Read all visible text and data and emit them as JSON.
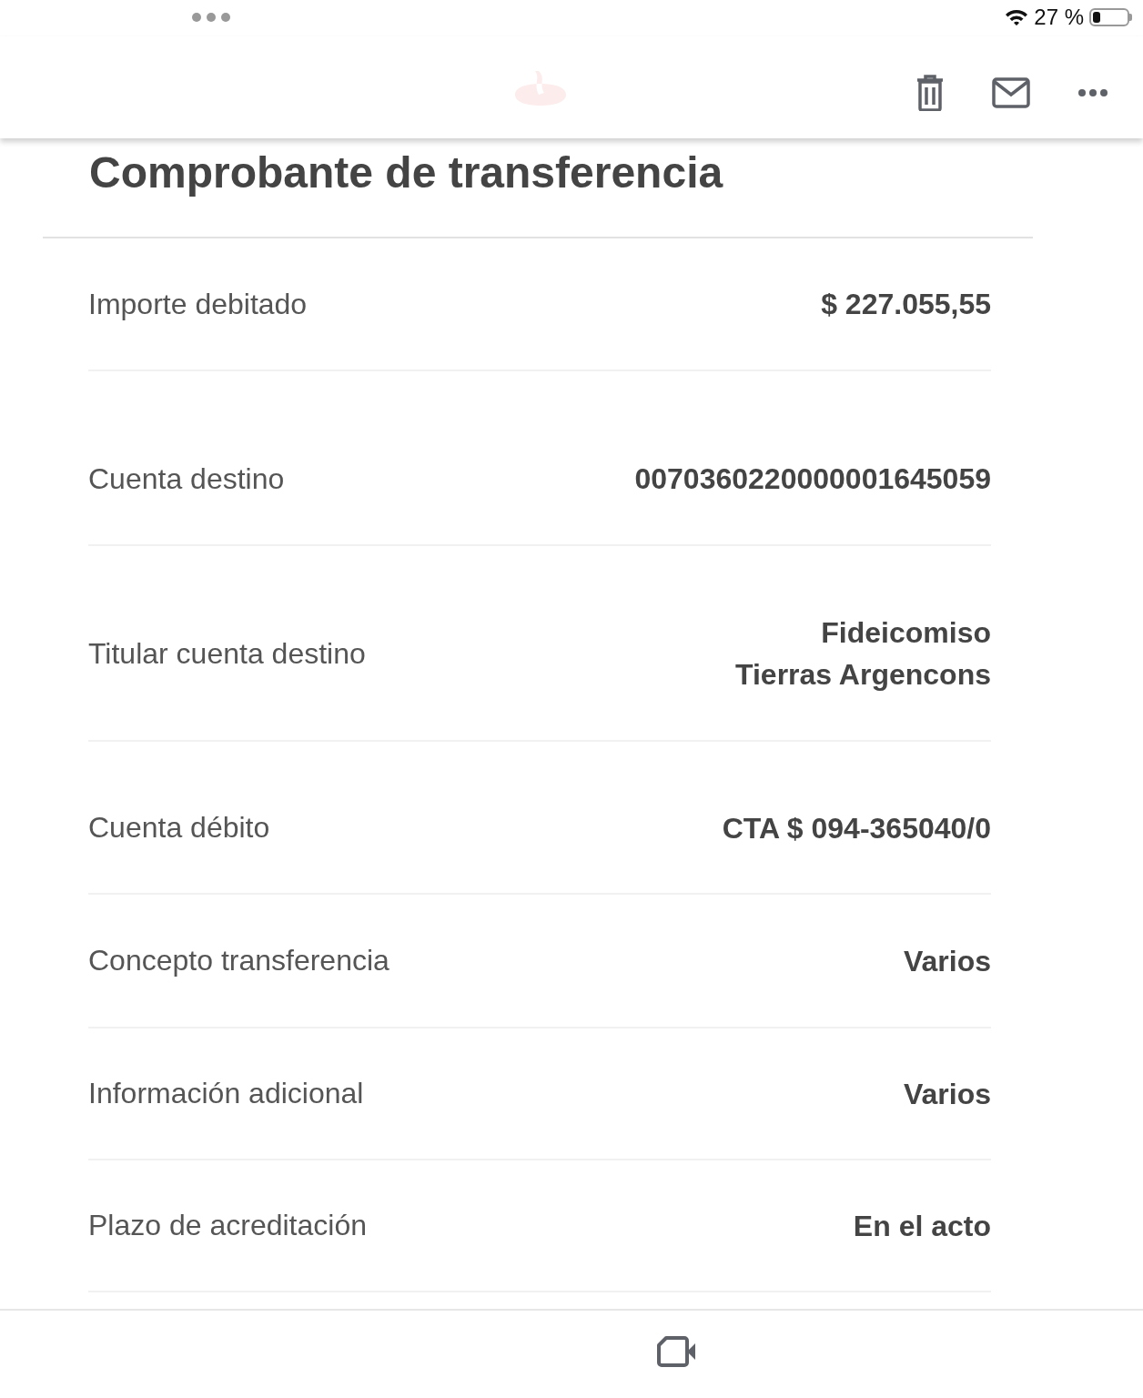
{
  "status_bar": {
    "battery_text": "27 %"
  },
  "title": "Comprobante de transferencia",
  "rows": [
    {
      "label": "Importe debitado",
      "value": [
        "$ 227.055,55"
      ]
    },
    {
      "label": "Cuenta destino",
      "value": [
        "0070360220000001645059"
      ]
    },
    {
      "label": "Titular cuenta destino",
      "value": [
        "Fideicomiso",
        "Tierras Argencons"
      ]
    },
    {
      "label": "Cuenta débito",
      "value": [
        "CTA $ 094-365040/0"
      ]
    },
    {
      "label": "Concepto transferencia",
      "value": [
        "Varios"
      ]
    },
    {
      "label": "Información adicional",
      "value": [
        "Varios"
      ]
    },
    {
      "label": "Plazo de acreditación",
      "value": [
        "En el acto"
      ]
    }
  ]
}
